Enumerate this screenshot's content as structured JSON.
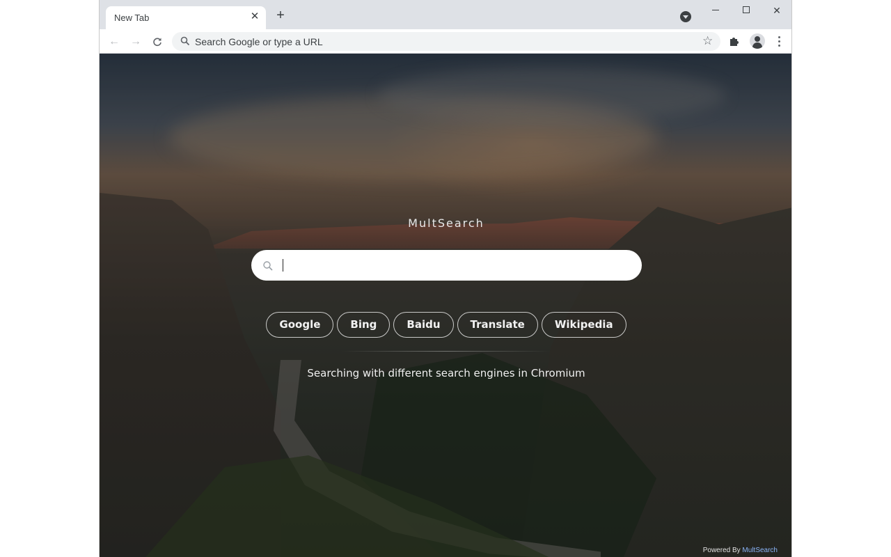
{
  "tab": {
    "title": "New Tab",
    "close_glyph": "✕",
    "new_tab_glyph": "+"
  },
  "window_controls": {
    "minimize": "minimize-icon",
    "maximize": "maximize-icon",
    "close_glyph": "✕"
  },
  "toolbar": {
    "back_glyph": "←",
    "forward_glyph": "→",
    "reload_glyph": "C",
    "omnibox_placeholder": "Search Google or type a URL",
    "star_glyph": "☆"
  },
  "page": {
    "brand": "MultSearch",
    "search_value": "",
    "engines": [
      "Google",
      "Bing",
      "Baidu",
      "Translate",
      "Wikipedia"
    ],
    "tagline": "Searching with different search engines in Chromium",
    "powered_prefix": "Powered By",
    "powered_brand": "MultSearch"
  },
  "colors": {
    "accent": "#8ab4f8",
    "toolbar": "#ffffff",
    "tabstrip": "#dee1e6"
  }
}
